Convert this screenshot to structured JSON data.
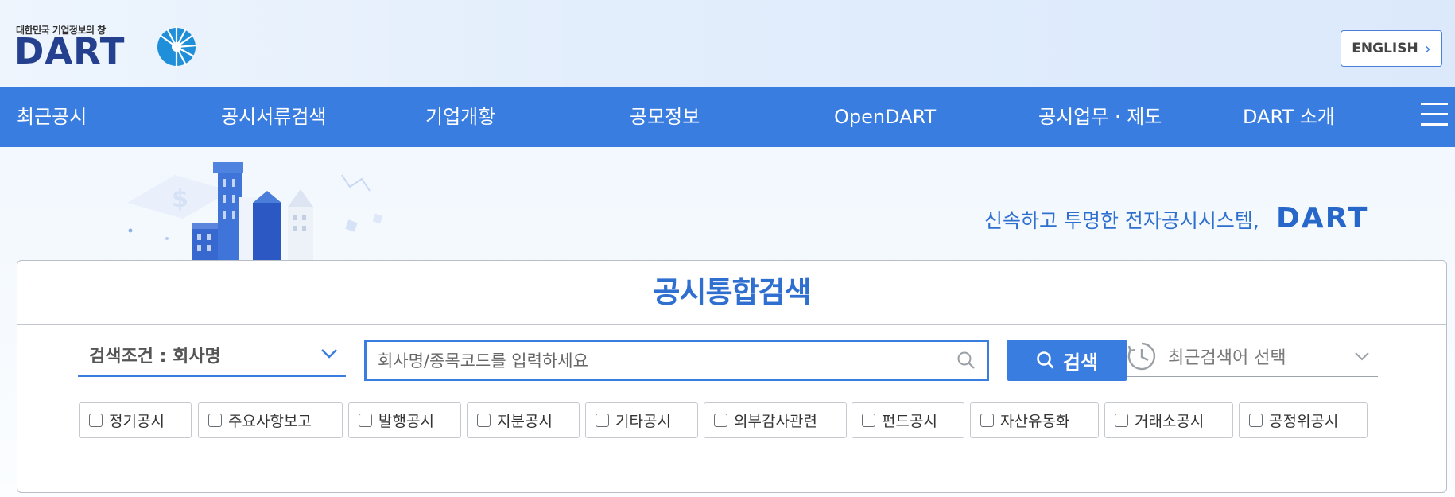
{
  "header": {
    "logo_subtitle": "대한민국 기업정보의 창",
    "logo_word": "DART",
    "english_label": "ENGLISH"
  },
  "nav": {
    "items": [
      {
        "label": "최근공시"
      },
      {
        "label": "공시서류검색"
      },
      {
        "label": "기업개황"
      },
      {
        "label": "공모정보"
      },
      {
        "label": "OpenDART"
      },
      {
        "label": "공시업무 · 제도"
      },
      {
        "label": "DART 소개"
      }
    ],
    "menu_icon": "hamburger-menu-icon"
  },
  "hero": {
    "slogan": "신속하고 투명한 전자공시시스템,",
    "slogan_brand": "DART"
  },
  "search": {
    "title": "공시통합검색",
    "condition_label": "검색조건 : 회사명",
    "input_placeholder": "회사명/종목코드를 입력하세요",
    "input_value": "",
    "search_button_label": "검색",
    "recent_label": "최근검색어 선택",
    "filters": [
      {
        "label": "정기공시",
        "checked": false
      },
      {
        "label": "주요사항보고",
        "checked": false
      },
      {
        "label": "발행공시",
        "checked": false
      },
      {
        "label": "지분공시",
        "checked": false
      },
      {
        "label": "기타공시",
        "checked": false
      },
      {
        "label": "외부감사관련",
        "checked": false
      },
      {
        "label": "펀드공시",
        "checked": false
      },
      {
        "label": "자산유동화",
        "checked": false
      },
      {
        "label": "거래소공시",
        "checked": false
      },
      {
        "label": "공정위공시",
        "checked": false
      }
    ]
  },
  "colors": {
    "nav_bg": "#3a7de0",
    "accent": "#2f6fcf",
    "logo": "#24408e"
  }
}
